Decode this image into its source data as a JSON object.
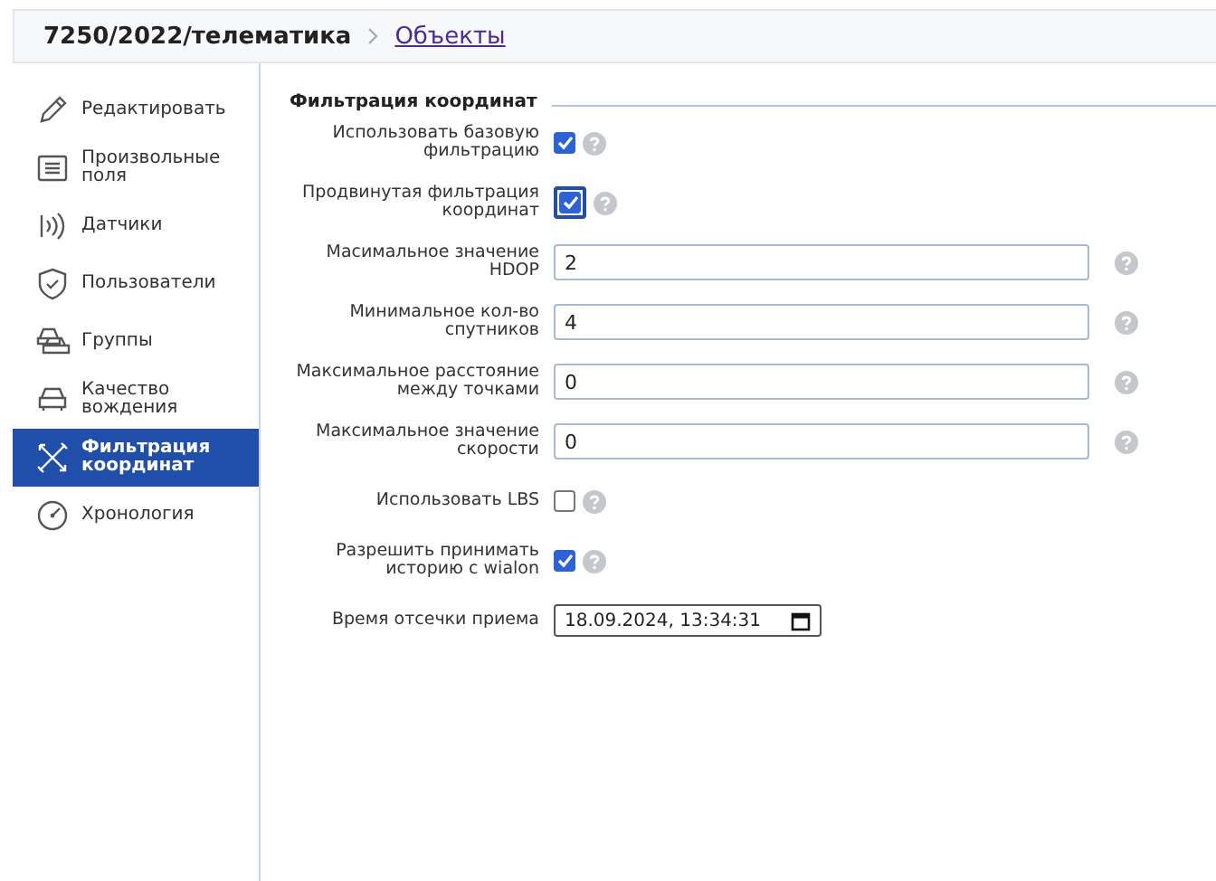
{
  "breadcrumb": {
    "title": "7250/2022/телематика",
    "link": "Объекты"
  },
  "sidebar": {
    "items": [
      {
        "label": "Редактировать",
        "selected": false
      },
      {
        "label": "Произвольные поля",
        "selected": false
      },
      {
        "label": "Датчики",
        "selected": false
      },
      {
        "label": "Пользователи",
        "selected": false
      },
      {
        "label": "Группы",
        "selected": false
      },
      {
        "label": "Качество вождения",
        "selected": false
      },
      {
        "label": "Фильтрация координат",
        "selected": true
      },
      {
        "label": "Хронология",
        "selected": false
      }
    ]
  },
  "section": {
    "title": "Фильтрация координат",
    "rows": [
      {
        "kind": "checkbox",
        "label": "Использовать базовую фильтрацию",
        "checked": true,
        "focused": false,
        "help": true
      },
      {
        "kind": "checkbox",
        "label": "Продвинутая фильтрация координат",
        "checked": true,
        "focused": true,
        "help": true
      },
      {
        "kind": "text",
        "label": "Масимальное значение HDOP",
        "value": "2",
        "help": true
      },
      {
        "kind": "text",
        "label": "Минимальное кол-во спутников",
        "value": "4",
        "help": true
      },
      {
        "kind": "text",
        "label": "Максимальное расстояние между точками",
        "value": "0",
        "help": true
      },
      {
        "kind": "text",
        "label": "Максимальное значение скорости",
        "value": "0",
        "help": true
      },
      {
        "kind": "checkbox",
        "label": "Использовать LBS",
        "checked": false,
        "focused": false,
        "help": true
      },
      {
        "kind": "checkbox",
        "label": "Разрешить принимать историю с wialon",
        "checked": true,
        "focused": false,
        "help": true
      },
      {
        "kind": "datetime",
        "label": "Время отсечки приема",
        "value": "18.09.2024, 13:34:31",
        "help": false
      }
    ]
  }
}
